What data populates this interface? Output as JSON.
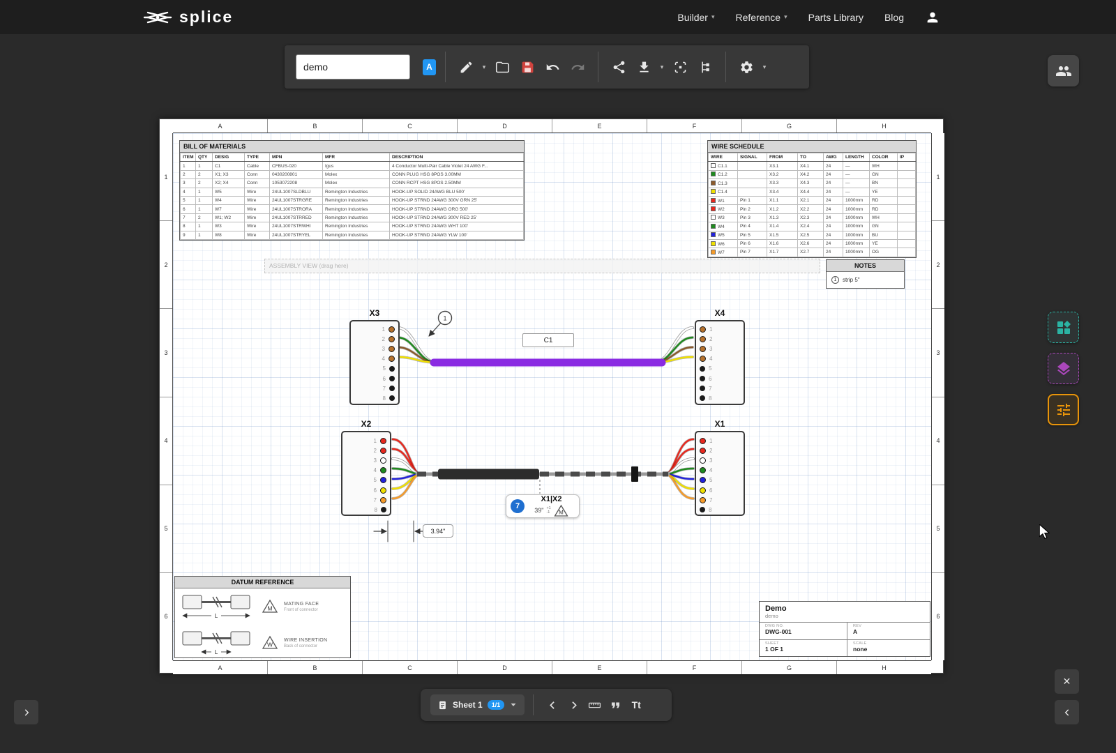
{
  "nav": {
    "logo": "splice",
    "items": [
      {
        "label": "Builder",
        "caret": true
      },
      {
        "label": "Reference",
        "caret": true
      },
      {
        "label": "Parts Library",
        "caret": false
      },
      {
        "label": "Blog",
        "caret": false
      }
    ]
  },
  "toolbar": {
    "filename": "demo",
    "badge_a": "A"
  },
  "icons": {
    "caret_down": "▾",
    "chevron_left": "‹",
    "chevron_right": "›",
    "close": "✕",
    "text_tool": "Tt"
  },
  "sheet": {
    "cols": [
      "A",
      "B",
      "C",
      "D",
      "E",
      "F",
      "G",
      "H"
    ],
    "rows": [
      "1",
      "2",
      "3",
      "4",
      "5",
      "6"
    ]
  },
  "bom": {
    "title": "BILL OF MATERIALS",
    "headers": [
      "ITEM",
      "QTY",
      "DESIG",
      "TYPE",
      "MPN",
      "MFR",
      "DESCRIPTION"
    ],
    "rows": [
      [
        "1",
        "1",
        "C1",
        "Cable",
        "CFBUS-020",
        "Igus",
        "4 Conductor Multi-Pair Cable Violet 24 AWG F..."
      ],
      [
        "2",
        "2",
        "X1; X3",
        "Conn",
        "0430200801",
        "Molex",
        "CONN PLUG HSG 8POS 3.00MM"
      ],
      [
        "3",
        "2",
        "X2; X4",
        "Conn",
        "1053072208",
        "Molex",
        "CONN RCPT HSG 8POS 2.50MM"
      ],
      [
        "4",
        "1",
        "W5",
        "Wire",
        "24UL1007SLDBLU",
        "Remington Industries",
        "HOOK-UP SOLID 24AWG BLU 500'"
      ],
      [
        "5",
        "1",
        "W4",
        "Wire",
        "24UL1007STRGRE",
        "Remington Industries",
        "HOOK-UP STRND 24AWG 300V GRN 25'"
      ],
      [
        "6",
        "1",
        "W7",
        "Wire",
        "24UL1007STRORA",
        "Remington Industries",
        "HOOK-UP STRND 24AWG ORG 500'"
      ],
      [
        "7",
        "2",
        "W1; W2",
        "Wire",
        "24UL1007STRRED",
        "Remington Industries",
        "HOOK-UP STRND 24AWG 300V RED 25'"
      ],
      [
        "8",
        "1",
        "W3",
        "Wire",
        "24UL1007STRWHI",
        "Remington Industries",
        "HOOK-UP STRND 24AWG WHT 100'"
      ],
      [
        "9",
        "1",
        "W8",
        "Wire",
        "24UL1007STRYEL",
        "Remington Industries",
        "HOOK-UP STRND 24AWG YLW 100'"
      ]
    ]
  },
  "wire_schedule": {
    "title": "WIRE SCHEDULE",
    "headers": [
      "WIRE",
      "SIGNAL",
      "FROM",
      "TO",
      "AWG",
      "LENGTH",
      "COLOR",
      "IP"
    ],
    "rows": [
      {
        "swatch": "#ffffff",
        "wire": "C1.1",
        "signal": "",
        "from": "X3.1",
        "to": "X4.1",
        "awg": "24",
        "length": "—",
        "color": "WH"
      },
      {
        "swatch": "#1e8a1e",
        "wire": "C1.2",
        "signal": "",
        "from": "X3.2",
        "to": "X4.2",
        "awg": "24",
        "length": "—",
        "color": "GN"
      },
      {
        "swatch": "#8b5a2b",
        "wire": "C1.3",
        "signal": "",
        "from": "X3.3",
        "to": "X4.3",
        "awg": "24",
        "length": "—",
        "color": "BN"
      },
      {
        "swatch": "#f0e000",
        "wire": "C1.4",
        "signal": "",
        "from": "X3.4",
        "to": "X4.4",
        "awg": "24",
        "length": "—",
        "color": "YE"
      },
      {
        "swatch": "#e8281e",
        "wire": "W1",
        "signal": "Pin 1",
        "from": "X1.1",
        "to": "X2.1",
        "awg": "24",
        "length": "1000mm",
        "color": "RD"
      },
      {
        "swatch": "#e8281e",
        "wire": "W2",
        "signal": "Pin 2",
        "from": "X1.2",
        "to": "X2.2",
        "awg": "24",
        "length": "1000mm",
        "color": "RD"
      },
      {
        "swatch": "#ffffff",
        "wire": "W3",
        "signal": "Pin 3",
        "from": "X1.3",
        "to": "X2.3",
        "awg": "24",
        "length": "1000mm",
        "color": "WH"
      },
      {
        "swatch": "#1e8a1e",
        "wire": "W4",
        "signal": "Pin 4",
        "from": "X1.4",
        "to": "X2.4",
        "awg": "24",
        "length": "1000mm",
        "color": "GN"
      },
      {
        "swatch": "#2222dd",
        "wire": "W5",
        "signal": "Pin 5",
        "from": "X1.5",
        "to": "X2.5",
        "awg": "24",
        "length": "1000mm",
        "color": "BU"
      },
      {
        "swatch": "#f0e000",
        "wire": "W6",
        "signal": "Pin 6",
        "from": "X1.6",
        "to": "X2.6",
        "awg": "24",
        "length": "1000mm",
        "color": "YE"
      },
      {
        "swatch": "#f59b2a",
        "wire": "W7",
        "signal": "Pin 7",
        "from": "X1.7",
        "to": "X2.7",
        "awg": "24",
        "length": "1000mm",
        "color": "OG"
      }
    ]
  },
  "notes": {
    "title": "NOTES",
    "items": [
      {
        "num": "1",
        "text": "strip 5\""
      }
    ]
  },
  "assembly_view": {
    "label": "ASSEMBLY VIEW (drag here)"
  },
  "diagram": {
    "cable_label": "C1",
    "callout_1": "1",
    "balloon": {
      "num": "7",
      "title": "X1|X2",
      "value": "39\"",
      "tol_plus": "+1",
      "tol_minus": "-1",
      "datum": "M"
    },
    "dim_label": "3.94\"",
    "connectors": {
      "x3": {
        "label": "X3",
        "side": "right",
        "pins": [
          {
            "n": "1",
            "c": "#b5712c"
          },
          {
            "n": "2",
            "c": "#b5712c"
          },
          {
            "n": "3",
            "c": "#b5712c"
          },
          {
            "n": "4",
            "c": "#b5712c"
          },
          {
            "n": "5",
            "c": "#1a1a1a"
          },
          {
            "n": "6",
            "c": "#1a1a1a"
          },
          {
            "n": "7",
            "c": "#1a1a1a"
          },
          {
            "n": "8",
            "c": "#1a1a1a"
          }
        ]
      },
      "x4": {
        "label": "X4",
        "side": "left",
        "pins": [
          {
            "n": "1",
            "c": "#b5712c"
          },
          {
            "n": "2",
            "c": "#b5712c"
          },
          {
            "n": "3",
            "c": "#b5712c"
          },
          {
            "n": "4",
            "c": "#b5712c"
          },
          {
            "n": "5",
            "c": "#1a1a1a"
          },
          {
            "n": "6",
            "c": "#1a1a1a"
          },
          {
            "n": "7",
            "c": "#1a1a1a"
          },
          {
            "n": "8",
            "c": "#1a1a1a"
          }
        ]
      },
      "x2": {
        "label": "X2",
        "side": "right",
        "pins": [
          {
            "n": "1",
            "c": "#e8281e"
          },
          {
            "n": "2",
            "c": "#e8281e"
          },
          {
            "n": "3",
            "c": "#ffffff"
          },
          {
            "n": "4",
            "c": "#1e8a1e"
          },
          {
            "n": "5",
            "c": "#2222dd"
          },
          {
            "n": "6",
            "c": "#f0e000"
          },
          {
            "n": "7",
            "c": "#f59b2a"
          },
          {
            "n": "8",
            "c": "#1a1a1a"
          }
        ]
      },
      "x1": {
        "label": "X1",
        "side": "left",
        "pins": [
          {
            "n": "1",
            "c": "#e8281e"
          },
          {
            "n": "2",
            "c": "#e8281e"
          },
          {
            "n": "3",
            "c": "#ffffff"
          },
          {
            "n": "4",
            "c": "#1e8a1e"
          },
          {
            "n": "5",
            "c": "#2222dd"
          },
          {
            "n": "6",
            "c": "#f0e000"
          },
          {
            "n": "7",
            "c": "#f59b2a"
          },
          {
            "n": "8",
            "c": "#1a1a1a"
          }
        ]
      }
    },
    "wires": {
      "top": [
        "#ffffff",
        "#1e8a1e",
        "#8b5a2b",
        "#f0e000"
      ],
      "bottom": [
        "#e8281e",
        "#e8281e",
        "#ffffff",
        "#1e8a1e",
        "#2222dd",
        "#f0e000",
        "#f59b2a"
      ],
      "cable": "#8a2be2"
    }
  },
  "datum_reference": {
    "title": "DATUM REFERENCE",
    "dim_label": "L",
    "rows": [
      {
        "symbol": "M",
        "label": "MATING FACE",
        "sub": "Front of connector"
      },
      {
        "symbol": "W",
        "label": "WIRE INSERTION",
        "sub": "Back of connector"
      }
    ]
  },
  "title_block": {
    "name": "Demo",
    "subtitle": "demo",
    "dwg_label": "DWG NO.",
    "dwg_no": "DWG-001",
    "rev_label": "REV",
    "rev": "A",
    "sheet_label": "SHEET",
    "sheet": "1 OF 1",
    "scale_label": "SCALE",
    "scale": "none"
  },
  "bottom_bar": {
    "sheet_name": "Sheet 1",
    "badge": "1/1"
  },
  "colors": {
    "accent_blue": "#2196f3",
    "save_red": "#d0433e",
    "teal": "#2bb3a3",
    "purple": "#ab47bc",
    "orange": "#e8940a"
  }
}
